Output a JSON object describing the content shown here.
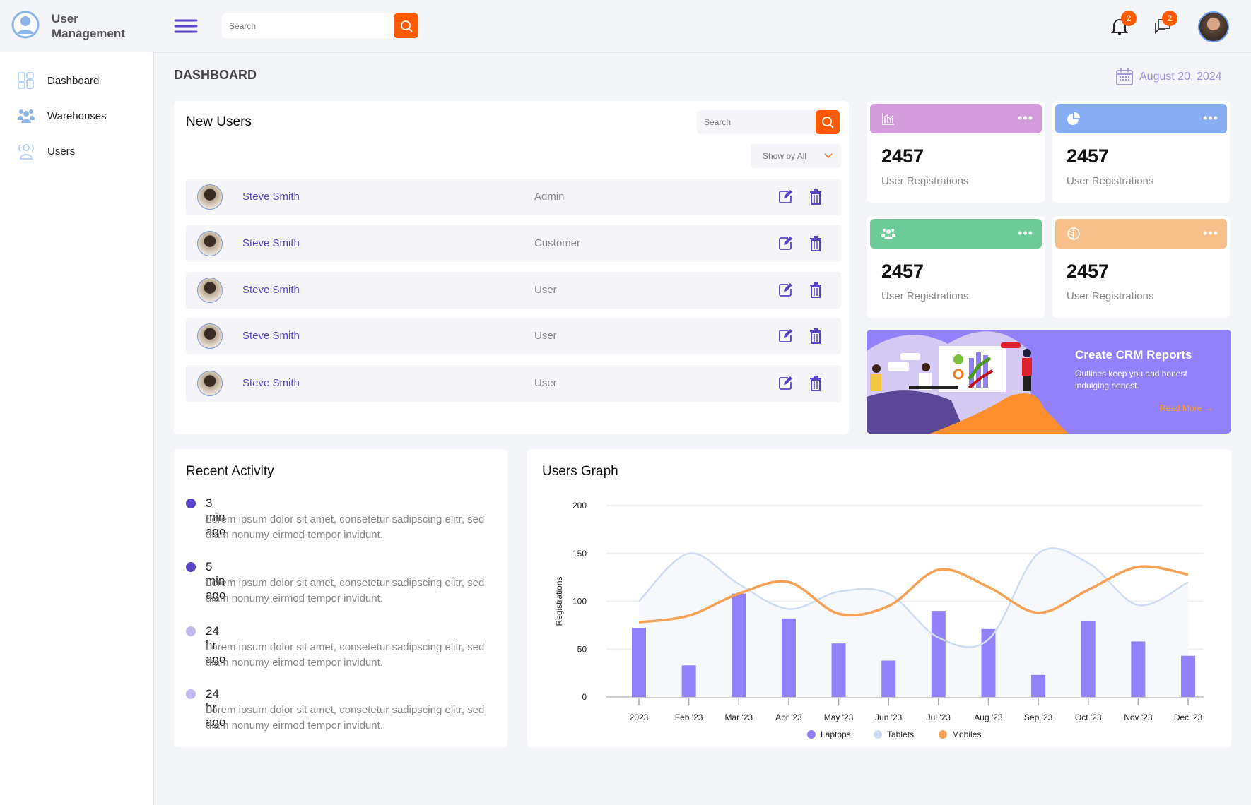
{
  "app": {
    "title": "User Management"
  },
  "sidebar": {
    "items": [
      {
        "label": "Dashboard",
        "icon": "grid-icon"
      },
      {
        "label": "Warehouses",
        "icon": "users-group-icon"
      },
      {
        "label": "Users",
        "icon": "user-outline-icon"
      }
    ]
  },
  "header": {
    "search_placeholder": "Search",
    "notifications_count": "2",
    "messages_count": "2"
  },
  "page": {
    "title": "DASHBOARD",
    "date": "August 20, 2024"
  },
  "new_users": {
    "title": "New Users",
    "search_placeholder": "Search",
    "filter": "Show by All",
    "rows": [
      {
        "name": "Steve Smith",
        "role": "Admin"
      },
      {
        "name": "Steve Smith",
        "role": "Customer"
      },
      {
        "name": "Steve Smith",
        "role": "User"
      },
      {
        "name": "Steve Smith",
        "role": "User"
      },
      {
        "name": "Steve Smith",
        "role": "User"
      }
    ]
  },
  "stats": [
    {
      "value": "2457",
      "label": "User Registrations",
      "color": "#d49bdc",
      "icon": "bar-chart-icon"
    },
    {
      "value": "2457",
      "label": "User Registrations",
      "color": "#87aef5",
      "icon": "pie-chart-icon"
    },
    {
      "value": "2457",
      "label": "User Registrations",
      "color": "#6ccb96",
      "icon": "users-icon"
    },
    {
      "value": "2457",
      "label": "User Registrations",
      "color": "#f7c08a",
      "icon": "half-circle-icon"
    }
  ],
  "banner": {
    "title": "Create CRM Reports",
    "text": "Outlines keep you and honest indulging honest.",
    "link": "Read More →",
    "color": "#9381fb"
  },
  "recent_activity": {
    "title": "Recent Activity",
    "items": [
      {
        "time": "3 min ago",
        "text": "Lorem ipsum dolor sit amet, consetetur sadipscing elitr, sed diam nonumy eirmod tempor invidunt.",
        "dot": "#5a44c6"
      },
      {
        "time": "5 min ago",
        "text": "Lorem ipsum dolor sit amet, consetetur sadipscing elitr, sed diam nonumy eirmod tempor invidunt.",
        "dot": "#5a44c6"
      },
      {
        "time": "24 hr ago",
        "text": "Lorem ipsum dolor sit amet, consetetur sadipscing elitr, sed diam nonumy eirmod tempor invidunt.",
        "dot": "#c2b8ee"
      },
      {
        "time": "24 hr ago",
        "text": "Lorem ipsum dolor sit amet, consetetur sadipscing elitr, sed diam nonumy eirmod tempor invidunt.",
        "dot": "#c2b8ee"
      }
    ]
  },
  "users_graph": {
    "title": "Users Graph"
  },
  "chart_data": {
    "type": "bar+line",
    "ylabel": "Registrations",
    "ylim": [
      0,
      200
    ],
    "yticks": [
      0,
      50,
      100,
      150,
      200
    ],
    "grid": true,
    "legend": "bottom",
    "categories": [
      "2023",
      "Feb '23",
      "Mar '23",
      "Apr '23",
      "May '23",
      "Jun '23",
      "Jul '23",
      "Aug '23",
      "Sep '23",
      "Oct '23",
      "Nov '23",
      "Dec '23"
    ],
    "series": [
      {
        "name": "Laptops",
        "type": "bar",
        "color": "#9381fb",
        "values": [
          72,
          33,
          108,
          82,
          56,
          38,
          90,
          71,
          23,
          79,
          58,
          43
        ]
      },
      {
        "name": "Tablets",
        "type": "area",
        "color": "#cfdcf0",
        "values": [
          100,
          150,
          118,
          92,
          110,
          108,
          62,
          60,
          150,
          140,
          96,
          120
        ]
      },
      {
        "name": "Mobiles",
        "type": "line",
        "color": "#f7a155",
        "values": [
          78,
          85,
          108,
          120,
          87,
          95,
          133,
          115,
          88,
          112,
          136,
          128
        ]
      }
    ]
  }
}
